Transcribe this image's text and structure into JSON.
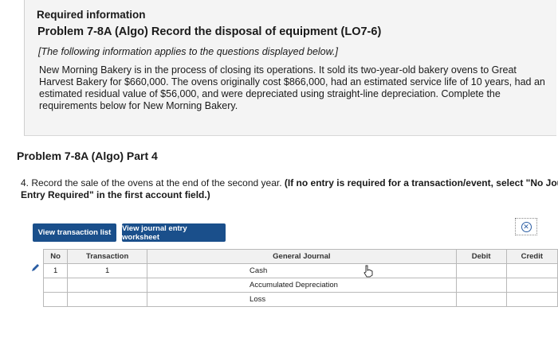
{
  "header": {
    "required_info": "Required information",
    "problem_title": "Problem 7-8A (Algo) Record the disposal of equipment (LO7-6)",
    "note": "[The following information applies to the questions displayed below.]",
    "paragraph": "New Morning Bakery is in the process of closing its operations. It sold its two-year-old bakery ovens to Great Harvest Bakery for $660,000. The ovens originally cost $866,000, had an estimated service life of 10 years, had an estimated residual value of $56,000, and were depreciated using straight-line depreciation. Complete the requirements below for New Morning Bakery."
  },
  "part": {
    "title": "Problem 7-8A (Algo) Part 4",
    "instruction_lead": "4. Record the sale of the ovens at the end of the second year.",
    "instruction_bold_1": " (If no entry is required for a transaction/event, select \"No Journa",
    "instruction_bold_2": "Entry Required\" in the first account field.)"
  },
  "toolbar": {
    "view_transaction_list": "View transaction list",
    "view_journal_worksheet": "View journal entry worksheet"
  },
  "journal": {
    "headers": {
      "no": "No",
      "transaction": "Transaction",
      "general_journal": "General Journal",
      "debit": "Debit",
      "credit": "Credit"
    },
    "rows": [
      {
        "no": "1",
        "transaction": "1",
        "account": "Cash",
        "debit": "",
        "credit": ""
      },
      {
        "no": "",
        "transaction": "",
        "account": "Accumulated Depreciation",
        "debit": "",
        "credit": ""
      },
      {
        "no": "",
        "transaction": "",
        "account": "Loss",
        "debit": "",
        "credit": ""
      }
    ]
  },
  "colors": {
    "button_blue": "#1a4f8b",
    "info_bg": "#f4f4f4"
  },
  "icons": {
    "close": "close-circle-icon",
    "edit": "pencil-icon",
    "cursor": "hand-cursor-icon"
  }
}
